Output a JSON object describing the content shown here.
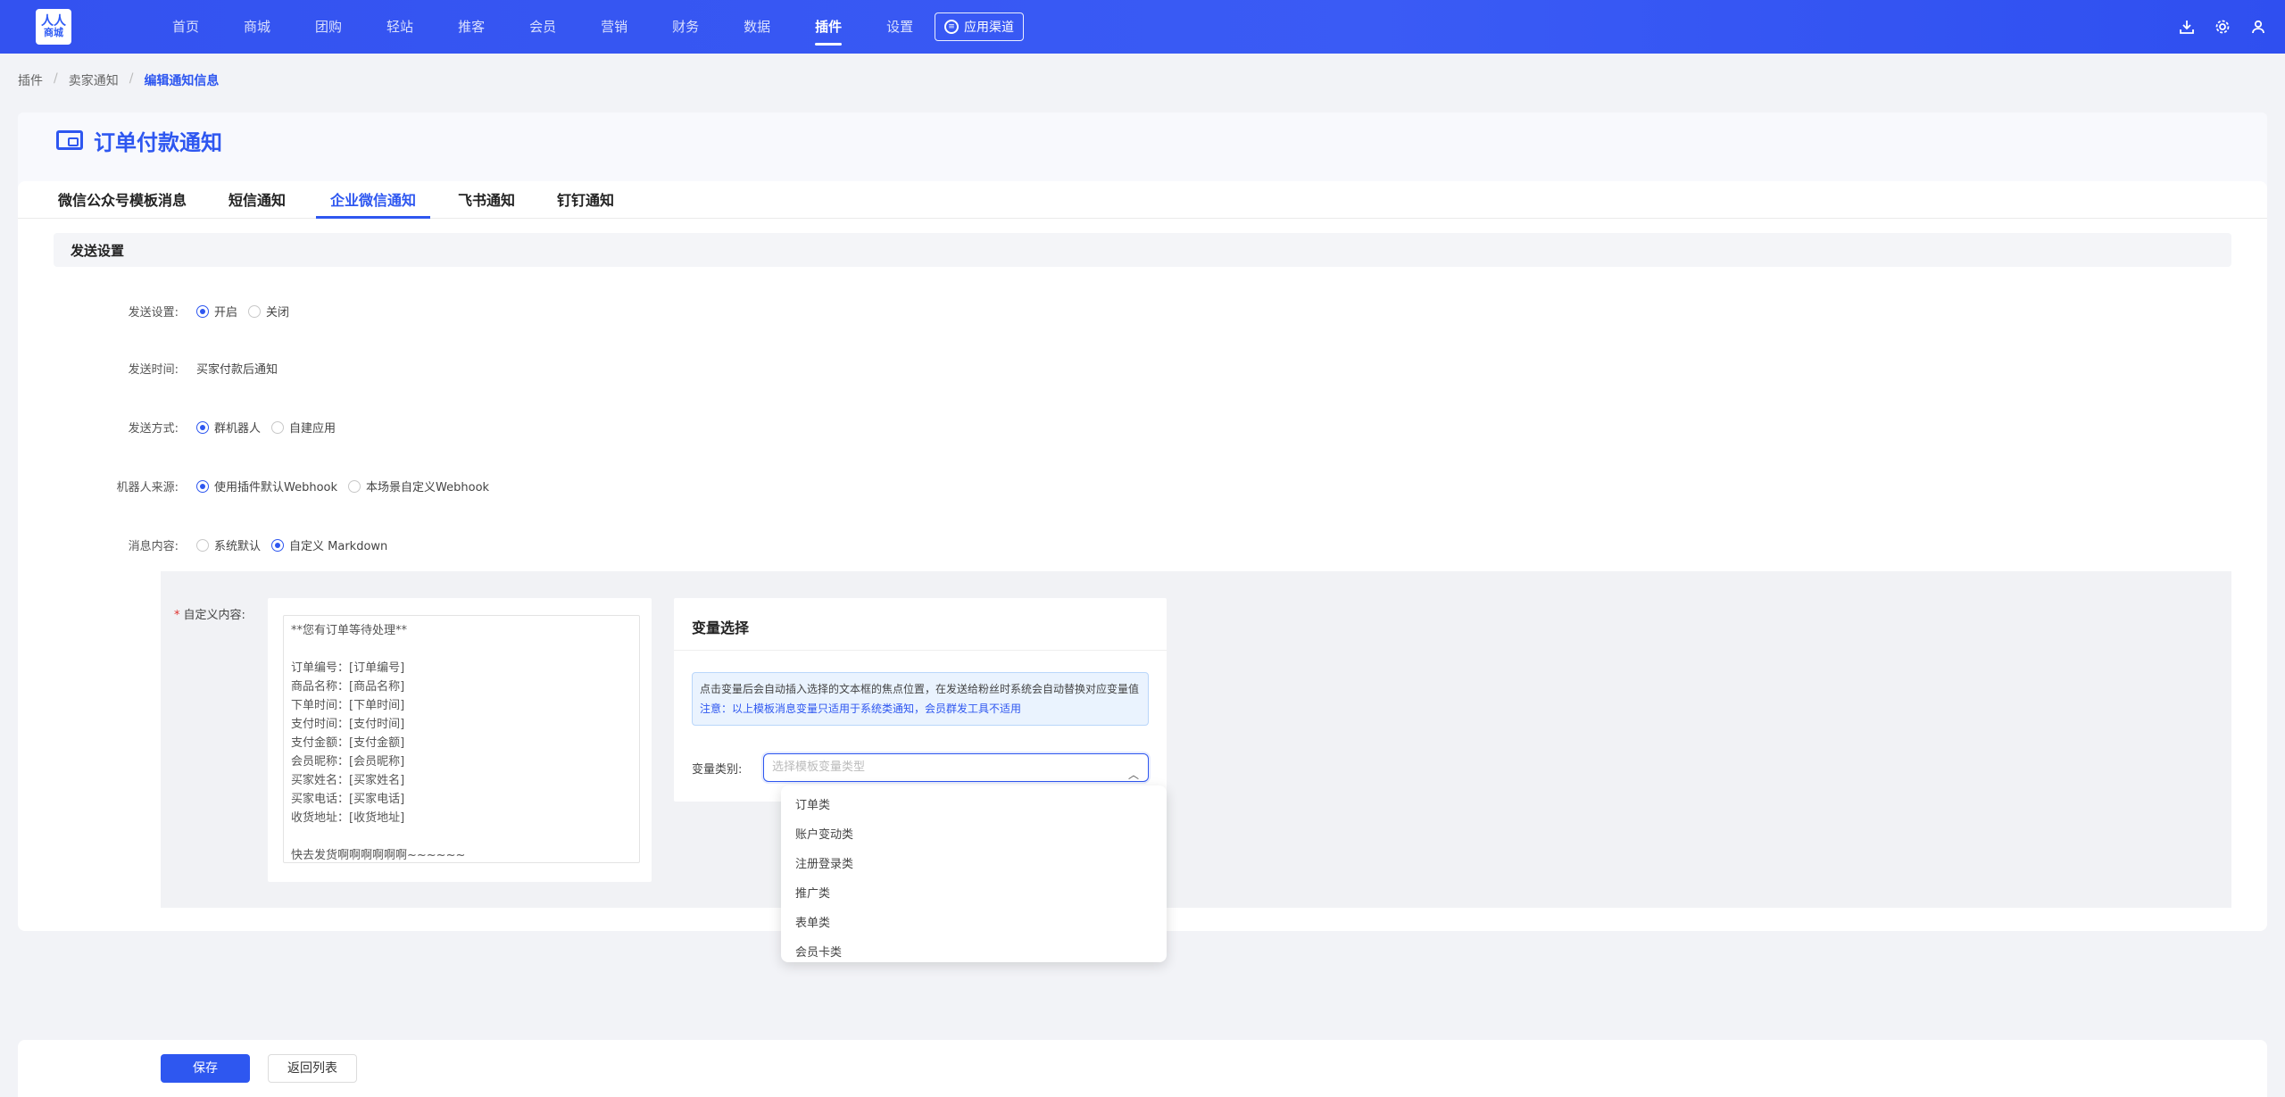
{
  "nav": {
    "logo_line1": "人人",
    "logo_line2": "商城",
    "items": [
      "首页",
      "商城",
      "团购",
      "轻站",
      "推客",
      "会员",
      "营销",
      "财务",
      "数据",
      "插件",
      "设置"
    ],
    "active": "插件",
    "app_channel": "应用渠道",
    "right_icons": [
      "download-icon",
      "gear-icon",
      "user-icon"
    ]
  },
  "breadcrumb": [
    "插件",
    "卖家通知",
    "编辑通知信息"
  ],
  "page_title": "订单付款通知",
  "tabs": [
    "微信公众号模板消息",
    "短信通知",
    "企业微信通知",
    "飞书通知",
    "钉钉通知"
  ],
  "active_tab": "企业微信通知",
  "section_title": "发送设置",
  "form": {
    "send_setting": {
      "label": "发送设置:",
      "options": [
        "开启",
        "关闭"
      ],
      "selected": "开启"
    },
    "send_time": {
      "label": "发送时间:",
      "value": "买家付款后通知"
    },
    "send_method": {
      "label": "发送方式:",
      "options": [
        "群机器人",
        "自建应用"
      ],
      "selected": "群机器人"
    },
    "robot_source": {
      "label": "机器人来源:",
      "options": [
        "使用插件默认Webhook",
        "本场景自定义Webhook"
      ],
      "selected": "使用插件默认Webhook"
    },
    "message_content": {
      "label": "消息内容:",
      "options": [
        "系统默认",
        "自定义 Markdown"
      ],
      "selected": "自定义 Markdown"
    },
    "custom_content": {
      "label": "自定义内容:",
      "value": "**您有订单等待处理**\n\n订单编号：[订单编号]\n商品名称：[商品名称]\n下单时间：[下单时间]\n支付时间：[支付时间]\n支付金额：[支付金额]\n会员昵称：[会员昵称]\n买家姓名：[买家姓名]\n买家电话：[买家电话]\n收货地址：[收货地址]\n\n快去发货啊啊啊啊啊啊~~~~~~"
    }
  },
  "variable_panel": {
    "title": "变量选择",
    "notice_line1": "点击变量后会自动插入选择的文本框的焦点位置，在发送给粉丝时系统会自动替换对应变量值",
    "notice_line2": "注意：以上模板消息变量只适用于系统类通知，会员群发工具不适用",
    "category_label": "变量类别:",
    "category_placeholder": "选择模板变量类型",
    "options": [
      "订单类",
      "账户变动类",
      "注册登录类",
      "推广类",
      "表单类",
      "会员卡类"
    ]
  },
  "footer": {
    "save": "保存",
    "back": "返回列表"
  },
  "colors": {
    "primary": "#2e57f0",
    "nav_bg": "#3352f0"
  }
}
